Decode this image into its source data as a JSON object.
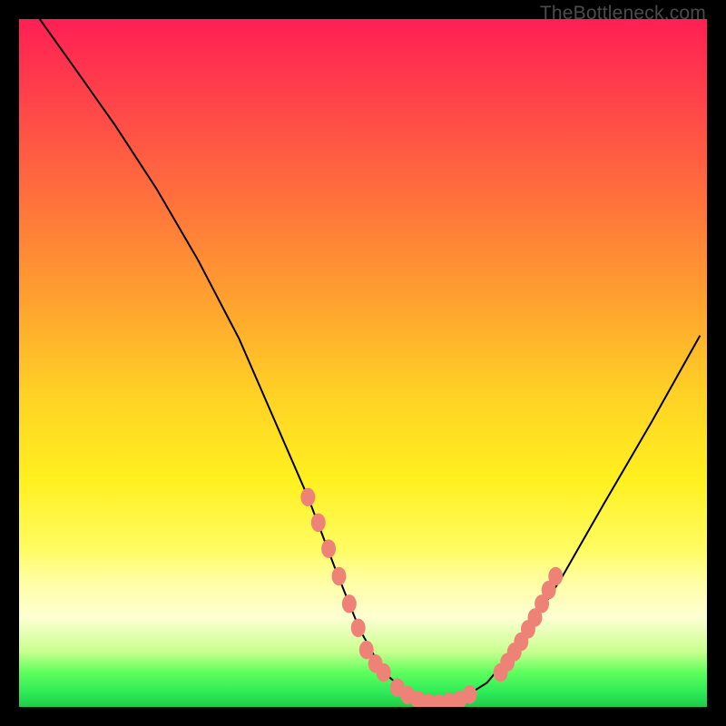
{
  "watermark": "TheBottleneck.com",
  "colors": {
    "background": "#000000",
    "curve_stroke": "#000000",
    "marker_fill": "#ee8277",
    "watermark": "#4b4b4b"
  },
  "chart_data": {
    "type": "line",
    "title": "",
    "xlabel": "",
    "ylabel": "",
    "xlim": [
      0,
      100
    ],
    "ylim": [
      0,
      100
    ],
    "grid": false,
    "legend": false,
    "annotations": [],
    "axes_hidden": true,
    "note": "No tick labels or numeric axes are rendered in the image; data points are estimated from pixel positions on a 0–100 normalized plot area.",
    "series": [
      {
        "name": "curve",
        "kind": "line",
        "x": [
          3.0,
          8.0,
          14.0,
          20.0,
          26.0,
          32.0,
          37.0,
          42.0,
          46.0,
          49.5,
          53.0,
          57.0,
          60.5,
          64.0,
          68.0,
          73.0,
          79.0,
          85.0,
          92.0,
          99.0
        ],
        "y": [
          100.0,
          93.0,
          84.5,
          75.3,
          65.0,
          53.5,
          42.0,
          30.5,
          20.0,
          11.3,
          5.0,
          1.7,
          0.5,
          1.0,
          3.5,
          9.5,
          19.0,
          29.5,
          41.5,
          54.0
        ]
      },
      {
        "name": "curve-highlight-left",
        "kind": "scatter",
        "x": [
          42.0,
          43.5,
          45.0,
          46.5,
          48.0,
          49.3,
          50.5,
          51.8,
          53.0
        ],
        "y": [
          30.5,
          26.8,
          23.0,
          19.0,
          15.0,
          11.5,
          8.3,
          6.3,
          5.0
        ]
      },
      {
        "name": "curve-highlight-bottom",
        "kind": "scatter",
        "x": [
          55.0,
          56.5,
          58.0,
          59.5,
          61.0,
          62.5,
          64.0,
          65.5
        ],
        "y": [
          2.8,
          1.7,
          1.0,
          0.6,
          0.5,
          0.7,
          1.0,
          1.8
        ]
      },
      {
        "name": "curve-highlight-right",
        "kind": "scatter",
        "x": [
          70.0,
          71.0,
          72.0,
          73.0,
          74.0,
          75.0,
          76.0,
          77.0,
          78.0
        ],
        "y": [
          5.0,
          6.5,
          8.0,
          9.5,
          11.3,
          13.0,
          15.0,
          17.0,
          19.0
        ]
      }
    ]
  }
}
